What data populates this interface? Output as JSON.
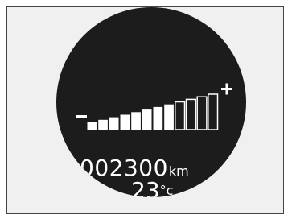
{
  "brightness_indicator": {
    "level": 8,
    "segments": 12,
    "minus_symbol": "minus-icon",
    "plus_symbol": "plus-icon"
  },
  "odometer": {
    "value": "002300",
    "unit": "km"
  },
  "temperature": {
    "value": "23",
    "unit": "°c"
  },
  "colors": {
    "display_background": "#1c1c1c",
    "segment_fill": "#ffffff",
    "frame_background": "#f0f0f0"
  }
}
